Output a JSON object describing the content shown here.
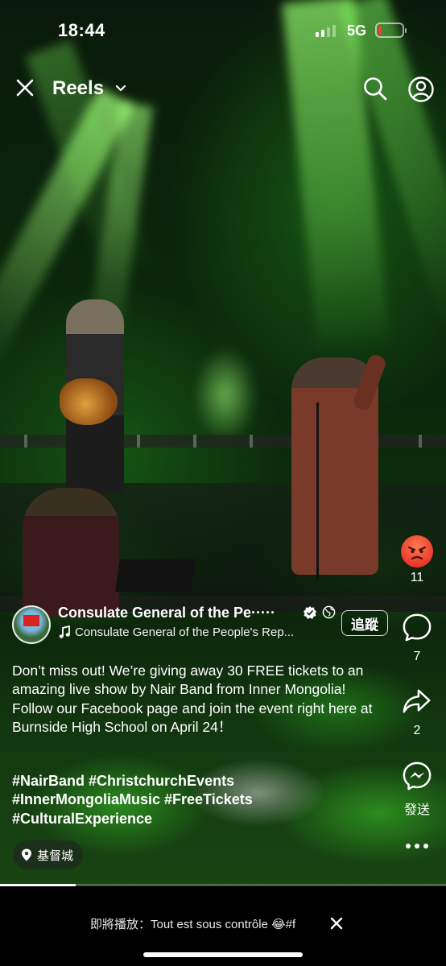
{
  "status_bar": {
    "time": "18:44",
    "network": "5G",
    "battery_level_fraction": 0.15
  },
  "nav": {
    "title": "Reels",
    "close_icon": "close-icon",
    "dropdown_icon": "chevron-down-icon",
    "search_icon": "search-icon",
    "profile_icon": "profile-icon"
  },
  "rail": {
    "reaction_count": "11",
    "comment_count": "7",
    "share_count": "2",
    "send_label": "發送"
  },
  "post": {
    "author": "Consulate General of the Pe·····",
    "audio": "Consulate General of the People's Rep...",
    "follow_label": "追蹤",
    "caption_line": "Don’t miss out!  We’re giving away 30 FREE tickets to an amazing live show by Nair Band from Inner Mongolia! Follow our Facebook page and join the event right here at Burnside High School on April 24！",
    "hashtags_1": "#NairBand #ChristchurchEvents",
    "hashtags_2": "#InnerMongoliaMusic #FreeTickets",
    "hashtags_3": "#CulturalExperience",
    "location": "基督城"
  },
  "playback": {
    "progress_fraction": 0.17
  },
  "bottom": {
    "up_next": "即將播放：Tout est sous contrôle 😂#f"
  },
  "colors": {
    "accent_battery": "#ff3b30",
    "reaction": "#e8342a"
  }
}
